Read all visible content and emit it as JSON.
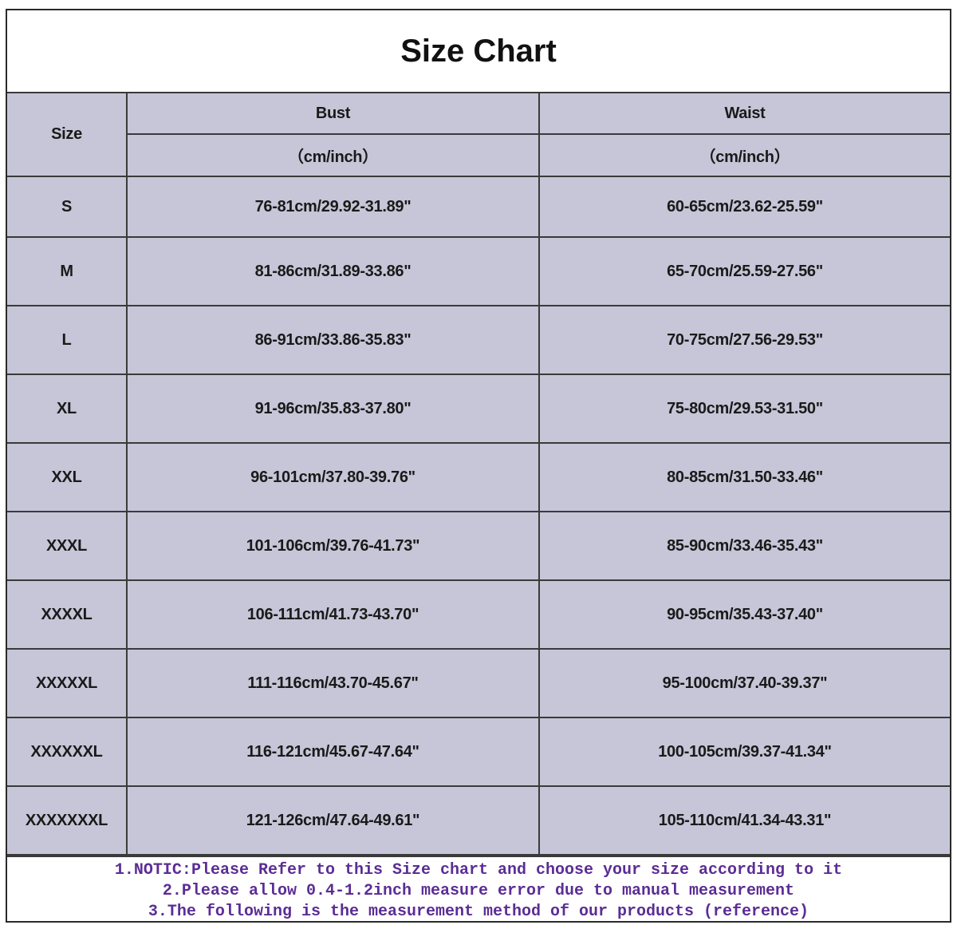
{
  "title": "Size Chart",
  "table": {
    "headers": {
      "size": "Size",
      "bust": "Bust",
      "waist": "Waist",
      "bust_unit": "（cm/inch）",
      "waist_unit": "（cm/inch）"
    },
    "rows": [
      {
        "size": "S",
        "bust": "76-81cm/29.92-31.89\"",
        "waist": "60-65cm/23.62-25.59\""
      },
      {
        "size": "M",
        "bust": "81-86cm/31.89-33.86\"",
        "waist": "65-70cm/25.59-27.56\""
      },
      {
        "size": "L",
        "bust": "86-91cm/33.86-35.83\"",
        "waist": "70-75cm/27.56-29.53\""
      },
      {
        "size": "XL",
        "bust": "91-96cm/35.83-37.80\"",
        "waist": "75-80cm/29.53-31.50\""
      },
      {
        "size": "XXL",
        "bust": "96-101cm/37.80-39.76\"",
        "waist": "80-85cm/31.50-33.46\""
      },
      {
        "size": "XXXL",
        "bust": "101-106cm/39.76-41.73\"",
        "waist": "85-90cm/33.46-35.43\""
      },
      {
        "size": "XXXXL",
        "bust": "106-111cm/41.73-43.70\"",
        "waist": "90-95cm/35.43-37.40\""
      },
      {
        "size": "XXXXXL",
        "bust": "111-116cm/43.70-45.67\"",
        "waist": "95-100cm/37.40-39.37\""
      },
      {
        "size": "XXXXXXL",
        "bust": "116-121cm/45.67-47.64\"",
        "waist": "100-105cm/39.37-41.34\""
      },
      {
        "size": "XXXXXXXL",
        "bust": "121-126cm/47.64-49.61\"",
        "waist": "105-110cm/41.34-43.31\""
      }
    ]
  },
  "notes": [
    "1.NOTIC:Please Refer to this Size chart and choose your size according to it",
    "2.Please allow 0.4-1.2inch measure error due to manual measurement",
    "3.The following is the measurement method of our products (reference)"
  ],
  "colors": {
    "table_background": "#c6c6d8",
    "grid_lines": "#3a3a3a",
    "notes_text": "#5b2d95"
  }
}
